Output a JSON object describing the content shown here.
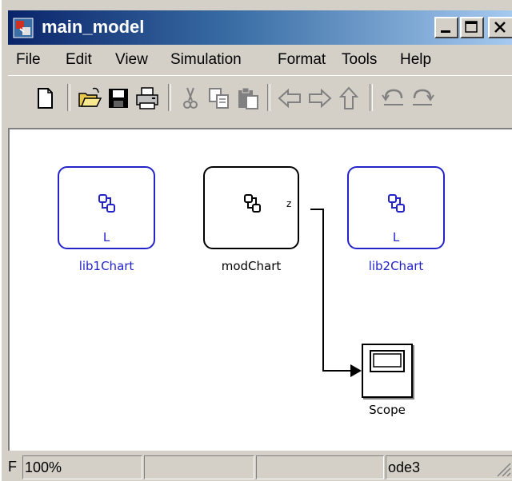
{
  "window": {
    "title": "main_model"
  },
  "menu": {
    "items": [
      "File",
      "Edit",
      "View",
      "Simulation",
      "Format",
      "Tools",
      "Help"
    ]
  },
  "blocks": {
    "lib1": {
      "label": "lib1Chart",
      "tag": "L"
    },
    "mod": {
      "label": "modChart",
      "port": "z"
    },
    "lib2": {
      "label": "lib2Chart",
      "tag": "L"
    },
    "scope": {
      "label": "Scope"
    }
  },
  "status": {
    "left": "F",
    "zoom": "100%",
    "solver": "ode3"
  },
  "colors": {
    "library_link": "#2323c8",
    "title_start": "#0a246a",
    "title_end": "#a6caf0"
  }
}
